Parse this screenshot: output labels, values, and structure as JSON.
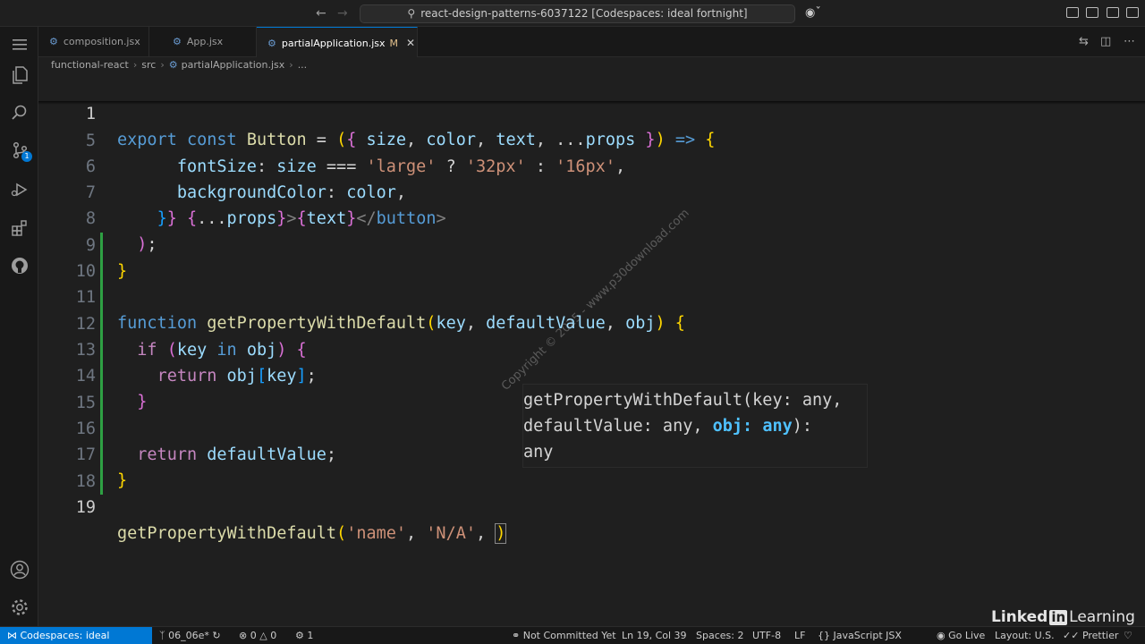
{
  "titlebar": {
    "title": "react-design-patterns-6037122 [Codespaces: ideal fortnight]",
    "back_icon": "arrow-left-icon",
    "forward_icon": "arrow-right-icon"
  },
  "tabs": [
    {
      "label": "composition.jsx"
    },
    {
      "label": "App.jsx"
    },
    {
      "label": "partialApplication.jsx",
      "modified": "M",
      "close": "✕"
    }
  ],
  "breadcrumb": {
    "items": [
      "functional-react",
      "src",
      "partialApplication.jsx",
      "..."
    ]
  },
  "activity": {
    "scm_badge": "1"
  },
  "editor": {
    "lines": [
      {
        "n": "1"
      },
      {
        "n": "5"
      },
      {
        "n": "6"
      },
      {
        "n": "7"
      },
      {
        "n": "8"
      },
      {
        "n": "9"
      },
      {
        "n": "10"
      },
      {
        "n": "11"
      },
      {
        "n": "12"
      },
      {
        "n": "13"
      },
      {
        "n": "14"
      },
      {
        "n": "15"
      },
      {
        "n": "16"
      },
      {
        "n": "17"
      },
      {
        "n": "18"
      },
      {
        "n": "19"
      }
    ],
    "hover": [
      "getPropertyWithDefault(key: any,",
      "defaultValue: any, obj: any):",
      "any"
    ]
  },
  "watermark": "Copyright © 2025 - www.p30download.com",
  "statusbar": {
    "remote": "Codespaces: ideal fortnight",
    "branch": "06_06e*",
    "errors": "0",
    "warnings": "0",
    "ports": "1",
    "blame": "Not Committed Yet",
    "position": "Ln 19, Col 39",
    "spaces": "Spaces: 2",
    "encoding": "UTF-8",
    "eol": "LF",
    "language": "JavaScript JSX",
    "golive": "Go Live",
    "layout": "Layout: U.S.",
    "prettier": "Prettier"
  },
  "branding": {
    "linked": "Linked",
    "in": "in",
    "learning": "Learning"
  },
  "colors": {
    "accent": "#0078d4",
    "editor_bg": "#1f1f1f",
    "keyword": "#569cd6",
    "function": "#dcdcaa",
    "string": "#ce9178",
    "variable": "#9cdcfe",
    "git_added": "#2ea043"
  }
}
